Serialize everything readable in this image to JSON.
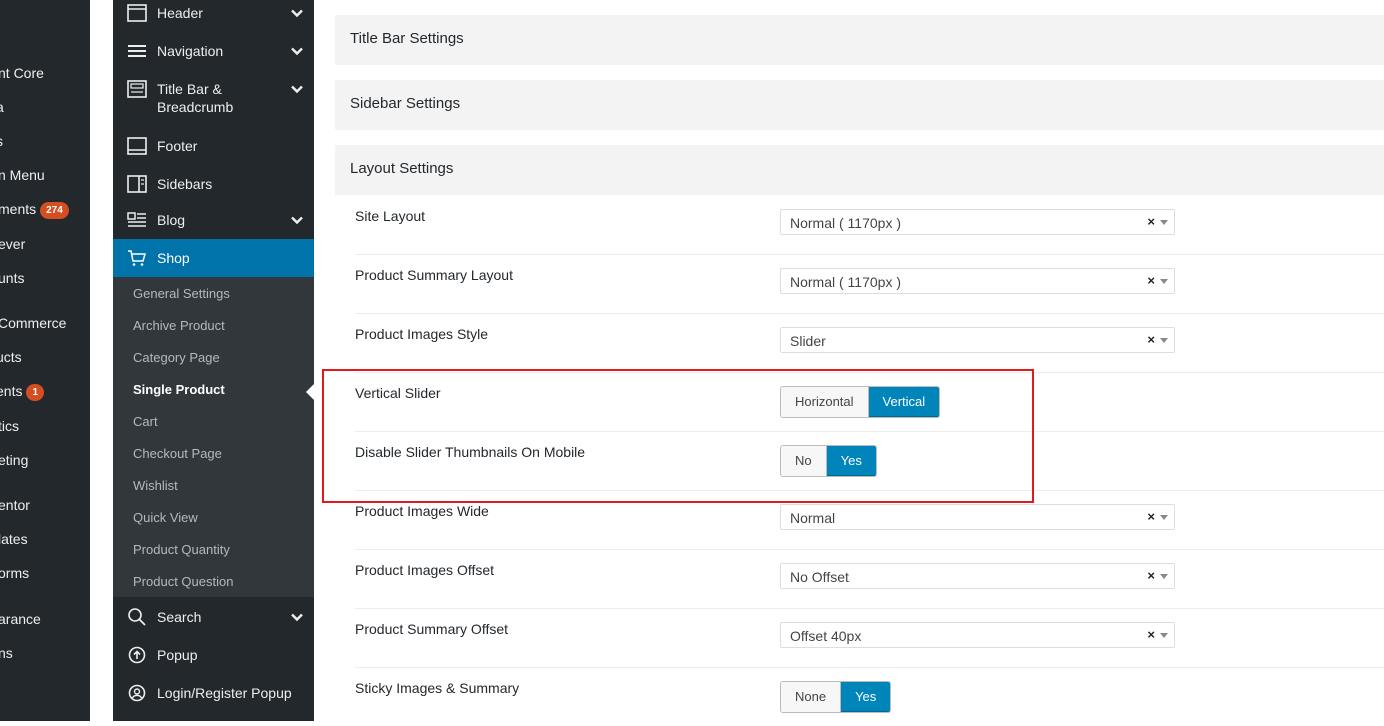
{
  "wp_menu": {
    "items": [
      {
        "label": "nt Core"
      },
      {
        "label": "a"
      },
      {
        "label": "s"
      },
      {
        "label": "n Menu"
      },
      {
        "label": "ments",
        "badge": "274"
      },
      {
        "label": "ever"
      },
      {
        "label": "unts"
      },
      {
        "label": "Commerce"
      },
      {
        "label": "ucts"
      },
      {
        "label": "ents",
        "badge": "1"
      },
      {
        "label": "tics"
      },
      {
        "label": "eting"
      },
      {
        "label": "entor"
      },
      {
        "label": "lates"
      },
      {
        "label": "orms"
      },
      {
        "label": "arance"
      },
      {
        "label": "ns"
      }
    ]
  },
  "panel_nav": {
    "items": [
      {
        "label": "Header",
        "icon": "header-icon",
        "has_chevron": true
      },
      {
        "label": "Navigation",
        "icon": "menu-icon",
        "has_chevron": true
      },
      {
        "label": "Title Bar &\nBreadcrumb",
        "icon": "titlebar-icon",
        "has_chevron": true
      },
      {
        "label": "Footer",
        "icon": "footer-icon",
        "has_chevron": false
      },
      {
        "label": "Sidebars",
        "icon": "sidebars-icon",
        "has_chevron": false
      },
      {
        "label": "Blog",
        "icon": "blog-icon",
        "has_chevron": true
      },
      {
        "label": "Shop",
        "icon": "cart-icon",
        "has_chevron": false,
        "active": true
      },
      {
        "label": "Search",
        "icon": "search-icon",
        "has_chevron": true
      },
      {
        "label": "Popup",
        "icon": "popup-icon",
        "has_chevron": false
      },
      {
        "label": "Login/Register Popup",
        "icon": "user-icon",
        "has_chevron": false
      }
    ],
    "shop_sub_items": [
      {
        "label": "General Settings"
      },
      {
        "label": "Archive Product"
      },
      {
        "label": "Category Page"
      },
      {
        "label": "Single Product",
        "current": true
      },
      {
        "label": "Cart"
      },
      {
        "label": "Checkout Page"
      },
      {
        "label": "Wishlist"
      },
      {
        "label": "Quick View"
      },
      {
        "label": "Product Quantity"
      },
      {
        "label": "Product Question"
      }
    ]
  },
  "sections": {
    "title_bar": "Title Bar Settings",
    "sidebar": "Sidebar Settings",
    "layout": "Layout Settings"
  },
  "layout_settings": [
    {
      "label": "Site Layout",
      "type": "select",
      "value": "Normal ( 1170px )"
    },
    {
      "label": "Product Summary Layout",
      "type": "select",
      "value": "Normal ( 1170px )"
    },
    {
      "label": "Product Images Style",
      "type": "select",
      "value": "Slider"
    },
    {
      "label": "Vertical Slider",
      "type": "toggle",
      "options": [
        "Horizontal",
        "Vertical"
      ],
      "selected": "Vertical"
    },
    {
      "label": "Disable Slider Thumbnails On Mobile",
      "type": "toggle",
      "options": [
        "No",
        "Yes"
      ],
      "selected": "Yes"
    },
    {
      "label": "Product Images Wide",
      "type": "select",
      "value": "Normal"
    },
    {
      "label": "Product Images Offset",
      "type": "select",
      "value": "No Offset"
    },
    {
      "label": "Product Summary Offset",
      "type": "select",
      "value": "Offset 40px"
    },
    {
      "label": "Sticky Images & Summary",
      "type": "toggle",
      "options": [
        "None",
        "Yes"
      ],
      "selected": "Yes"
    }
  ],
  "select_clear_glyph": "×",
  "colors": {
    "accent": "#0073aa",
    "toggle_on": "#0085ba",
    "highlight": "#e01b1b",
    "badge": "#d54e21"
  }
}
